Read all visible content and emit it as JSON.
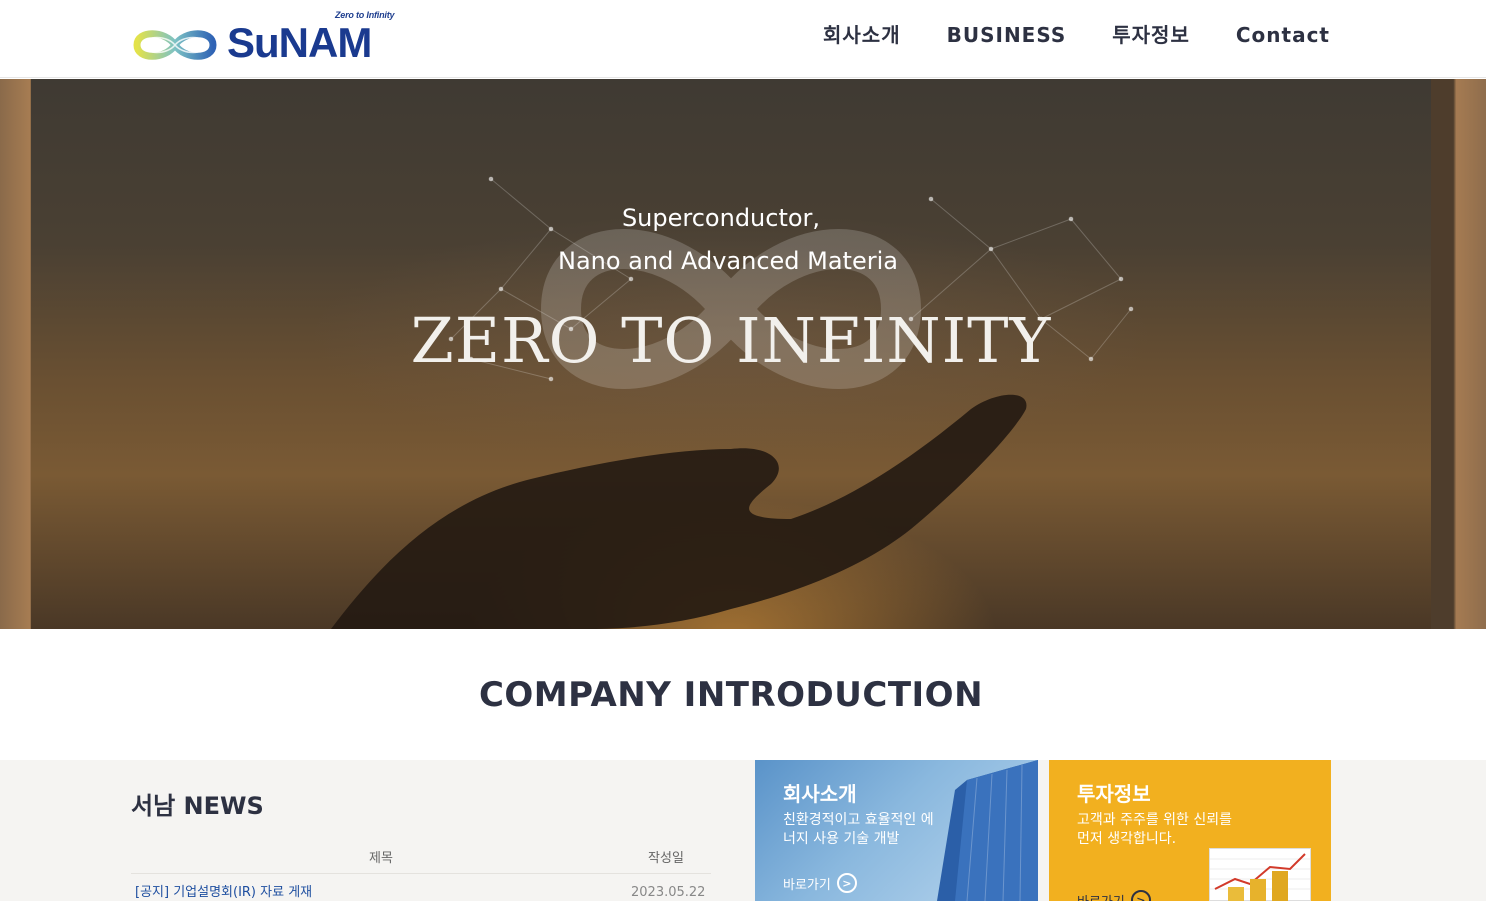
{
  "header": {
    "logo_tagline": "Zero to Infinity",
    "logo_text": "SuNAM",
    "nav": [
      "회사소개",
      "BUSINESS",
      "투자정보",
      "Contact"
    ]
  },
  "hero": {
    "line1": "Superconductor,",
    "line2": "Nano and Advanced Materia",
    "title": "ZERO TO INFINITY"
  },
  "intro": {
    "heading": "COMPANY INTRODUCTION"
  },
  "news": {
    "title": "서남 NEWS",
    "columns": [
      "제목",
      "작성일"
    ],
    "rows": [
      {
        "title": "[공지] 기업설명회(IR) 자료 게재",
        "date": "2023.05.22"
      }
    ]
  },
  "cards": {
    "company": {
      "title": "회사소개",
      "desc": "친환경적이고 효율적인 에너지 사용 기술 개발",
      "link": "바로가기"
    },
    "invest": {
      "title": "투자정보",
      "desc": "고객과 주주를 위한 신뢰를 먼저 생각합니다.",
      "link": "바로가기"
    }
  },
  "colors": {
    "brand_blue": "#1a3a8f",
    "invest_yellow": "#f2b01f",
    "text_dark": "#2d3142"
  }
}
